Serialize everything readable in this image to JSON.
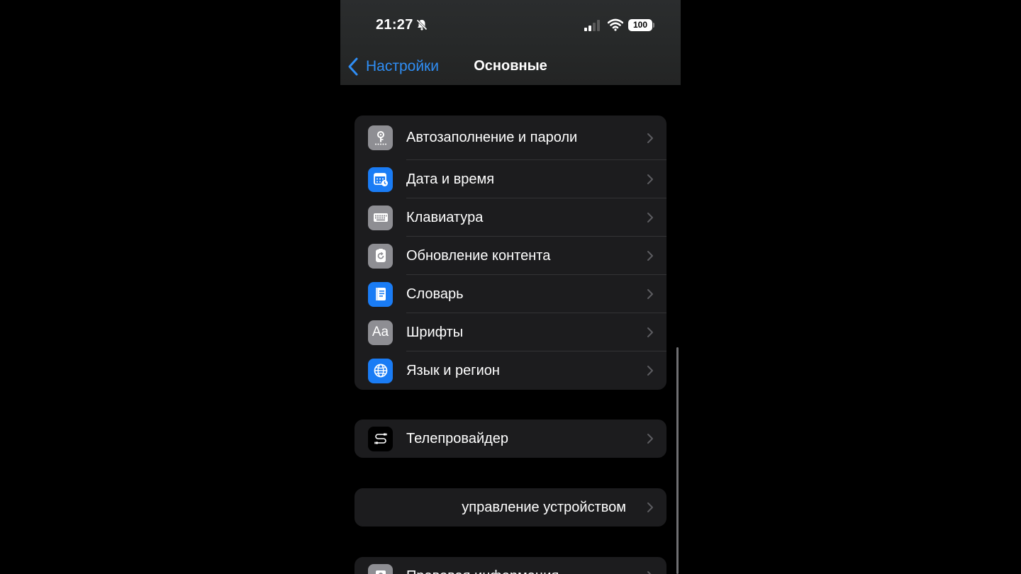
{
  "status_bar": {
    "time": "21:27",
    "battery": "100",
    "icons": [
      "bell-slash-icon",
      "signal-icon",
      "wifi-icon",
      "battery-icon"
    ]
  },
  "nav": {
    "back_label": "Настройки",
    "title": "Основные"
  },
  "group1": {
    "items": [
      {
        "label": "Автозаполнение и пароли",
        "icon": "key-icon",
        "icon_bg": "#8e8e93"
      },
      {
        "label": "Дата и время",
        "icon": "calendar-clock-icon",
        "icon_bg": "#1a7cf5"
      },
      {
        "label": "Клавиатура",
        "icon": "keyboard-icon",
        "icon_bg": "#8e8e93"
      },
      {
        "label": "Обновление контента",
        "icon": "refresh-icon",
        "icon_bg": "#8e8e93"
      },
      {
        "label": "Словарь",
        "icon": "book-icon",
        "icon_bg": "#1a7cf5"
      },
      {
        "label": "Шрифты",
        "icon": "fonts-icon",
        "icon_text": "Aa",
        "icon_bg": "#8e8e93"
      },
      {
        "label": "Язык и регион",
        "icon": "globe-icon",
        "icon_bg": "#1a7cf5"
      }
    ]
  },
  "group2": {
    "items": [
      {
        "label": "Телепровайдер",
        "icon": "tv-provider-icon",
        "icon_bg": "#000000"
      }
    ]
  },
  "group3": {
    "items": [
      {
        "label": "управление устройством"
      }
    ]
  },
  "group4": {
    "items": [
      {
        "label": "Правовая информация",
        "icon": "legal-icon",
        "icon_bg": "#8e8e93"
      }
    ]
  },
  "colors": {
    "accent": "#2f8ef5",
    "cell_bg": "#1c1c1e",
    "background": "#000000"
  }
}
